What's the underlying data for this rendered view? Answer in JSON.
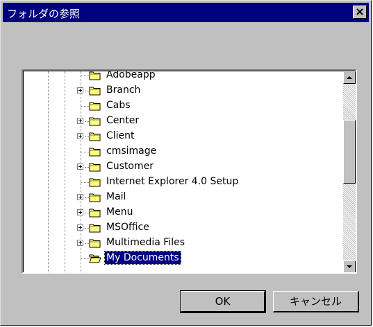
{
  "dialog": {
    "title": "フォルダの参照",
    "close_symbol": "×"
  },
  "tree": {
    "items": [
      {
        "label": "Adobeapp",
        "expandable": false,
        "selected": false,
        "icon": "folder-icon"
      },
      {
        "label": "Branch",
        "expandable": true,
        "selected": false,
        "icon": "folder-icon"
      },
      {
        "label": "Cabs",
        "expandable": false,
        "selected": false,
        "icon": "folder-icon"
      },
      {
        "label": "Center",
        "expandable": true,
        "selected": false,
        "icon": "folder-icon"
      },
      {
        "label": "Client",
        "expandable": true,
        "selected": false,
        "icon": "folder-icon"
      },
      {
        "label": "cmsimage",
        "expandable": false,
        "selected": false,
        "icon": "folder-icon"
      },
      {
        "label": "Customer",
        "expandable": true,
        "selected": false,
        "icon": "folder-icon"
      },
      {
        "label": "Internet Explorer 4.0 Setup",
        "expandable": false,
        "selected": false,
        "icon": "folder-icon"
      },
      {
        "label": "Mail",
        "expandable": true,
        "selected": false,
        "icon": "folder-icon"
      },
      {
        "label": "Menu",
        "expandable": true,
        "selected": false,
        "icon": "folder-icon"
      },
      {
        "label": "MSOffice",
        "expandable": true,
        "selected": false,
        "icon": "folder-icon"
      },
      {
        "label": "Multimedia Files",
        "expandable": true,
        "selected": false,
        "icon": "folder-icon"
      },
      {
        "label": "My Documents",
        "expandable": false,
        "selected": true,
        "icon": "open-folder-icon"
      }
    ]
  },
  "buttons": {
    "ok_label": "OK",
    "cancel_label": "キャンセル"
  },
  "colors": {
    "titlebar": "#000080",
    "face": "#c0c0c0",
    "selection": "#000080",
    "folder": "#ffff80"
  }
}
